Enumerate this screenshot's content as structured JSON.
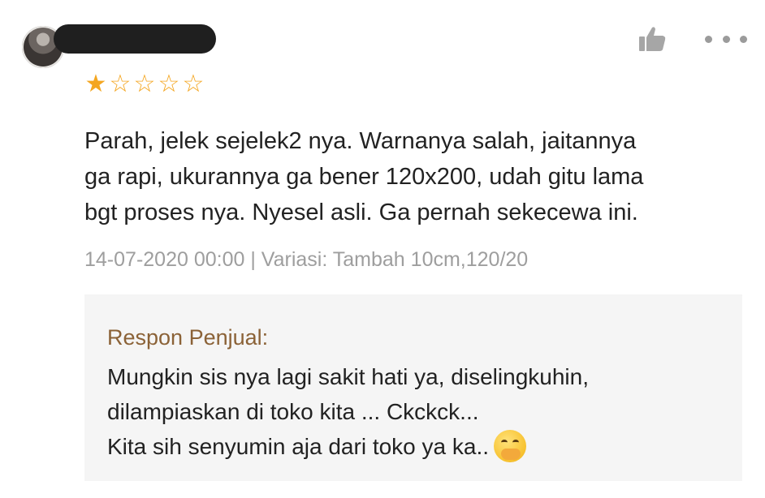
{
  "review": {
    "rating": 1,
    "rating_max": 5,
    "star_filled_glyph": "★",
    "star_empty_glyph": "☆",
    "text_lines": [
      "Parah, jelek sejelek2 nya. Warnanya salah, jaitannya",
      "ga rapi, ukurannya ga bener 120x200, udah gitu lama",
      "bgt proses nya. Nyesel asli. Ga pernah sekecewa ini."
    ],
    "meta": "14-07-2020 00:00 | Variasi: Tambah 10cm,120/20",
    "icons": {
      "like": "thumbs-up-icon",
      "more": "more-options-icon"
    }
  },
  "seller_response": {
    "label": "Respon Penjual:",
    "lines": [
      "Mungkin sis nya lagi sakit hati ya, diselingkuhin,",
      "dilampiaskan di toko kita ... Ckckck...",
      "Kita sih senyumin aja dari toko ya ka.."
    ],
    "emoji": "hand-over-mouth-emoji"
  },
  "colors": {
    "star": "#f4a621",
    "seller_label": "#8b6237",
    "meta_text": "#9e9e9e",
    "body_text": "#222222",
    "seller_box_bg": "#f5f5f5",
    "icon_gray": "#9b9b9b"
  }
}
